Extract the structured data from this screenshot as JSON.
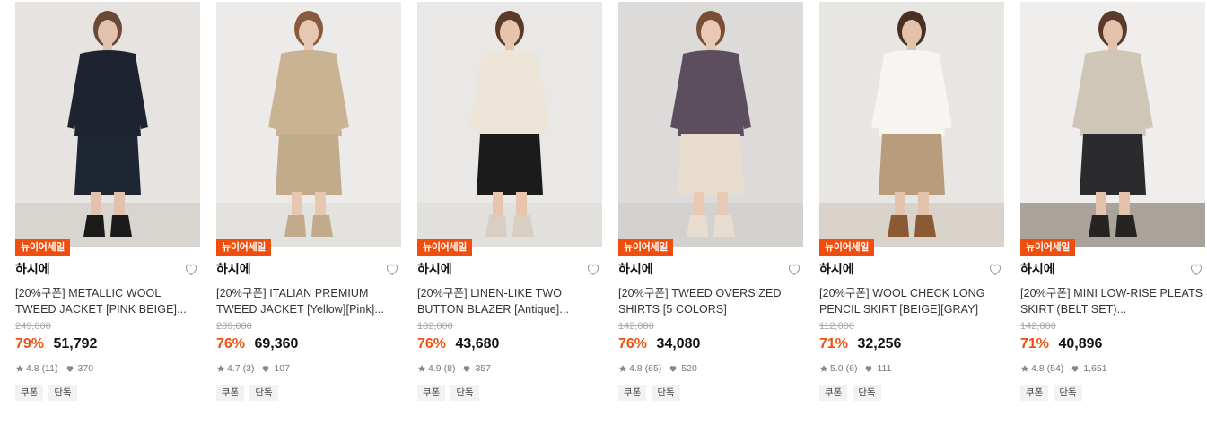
{
  "products": [
    {
      "badge": "뉴이어세일",
      "brand": "하시에",
      "title": "[20%쿠폰] METALLIC WOOL TWEED JACKET [PINK BEIGE]...",
      "original_price": "249,000",
      "discount": "79%",
      "price": "51,792",
      "rating": "4.8",
      "reviews": "(11)",
      "likes": "370",
      "tags": [
        "쿠폰",
        "단독"
      ],
      "image_colors": {
        "bg": "#e6e3e1",
        "floor": "#d8d4cf",
        "top": "#1d2430",
        "bottom": "#1f2633",
        "skin": "#e3c2ad",
        "hair": "#6a4a36",
        "shoes": "#1a1a1a"
      }
    },
    {
      "badge": "뉴이어세일",
      "brand": "하시에",
      "title": "[20%쿠폰] ITALIAN PREMIUM TWEED JACKET [Yellow][Pink]...",
      "original_price": "289,000",
      "discount": "76%",
      "price": "69,360",
      "rating": "4.7",
      "reviews": "(3)",
      "likes": "107",
      "tags": [
        "쿠폰",
        "단독"
      ],
      "image_colors": {
        "bg": "#ecebea",
        "floor": "#e4e2df",
        "top": "#c9b393",
        "bottom": "#c2ab8a",
        "skin": "#e8c7b2",
        "hair": "#8a5a3c",
        "shoes": "#c2ab8a"
      }
    },
    {
      "badge": "뉴이어세일",
      "brand": "하시에",
      "title": "[20%쿠폰] LINEN-LIKE TWO BUTTON BLAZER [Antique]...",
      "original_price": "182,000",
      "discount": "76%",
      "price": "43,680",
      "rating": "4.9",
      "reviews": "(8)",
      "likes": "357",
      "tags": [
        "쿠폰",
        "단독"
      ],
      "image_colors": {
        "bg": "#e9e8e6",
        "floor": "#e2e0dd",
        "top": "#ece5d8",
        "bottom": "#1b1b1b",
        "skin": "#e6c4ae",
        "hair": "#5a3a28",
        "shoes": "#d9cfc0"
      }
    },
    {
      "badge": "뉴이어세일",
      "brand": "하시에",
      "title": "[20%쿠폰] TWEED OVERSIZED SHIRTS [5 COLORS]",
      "original_price": "142,000",
      "discount": "76%",
      "price": "34,080",
      "rating": "4.8",
      "reviews": "(65)",
      "likes": "520",
      "tags": [
        "쿠폰",
        "단독"
      ],
      "image_colors": {
        "bg": "#dcdbd9",
        "floor": "#d4d2cf",
        "top": "#5c4e5e",
        "bottom": "#e7dccd",
        "skin": "#e9c9b4",
        "hair": "#7a4e34",
        "shoes": "#e7dccd"
      }
    },
    {
      "badge": "뉴이어세일",
      "brand": "하시에",
      "title": "[20%쿠폰] WOOL CHECK LONG PENCIL SKIRT [BEIGE][GRAY]",
      "original_price": "112,000",
      "discount": "71%",
      "price": "32,256",
      "rating": "5.0",
      "reviews": "(6)",
      "likes": "111",
      "tags": [
        "쿠폰",
        "단독"
      ],
      "image_colors": {
        "bg": "#e8e6e3",
        "floor": "#d9d3cb",
        "top": "#f6f5f2",
        "bottom": "#b99c7c",
        "skin": "#e3c1aa",
        "hair": "#4a3022",
        "shoes": "#8b5a33"
      }
    },
    {
      "badge": "뉴이어세일",
      "brand": "하시에",
      "title": "[20%쿠폰] MINI LOW-RISE PLEATS SKIRT (BELT SET)...",
      "original_price": "142,000",
      "discount": "71%",
      "price": "40,896",
      "rating": "4.8",
      "reviews": "(54)",
      "likes": "1,651",
      "tags": [
        "쿠폰",
        "단독"
      ],
      "image_colors": {
        "bg": "#efeeec",
        "floor": "#a9a39b",
        "top": "#cfc6b8",
        "bottom": "#2b2b2e",
        "skin": "#e3c1aa",
        "hair": "#5a3a28",
        "shoes": "#252422"
      }
    }
  ],
  "colors": {
    "accent": "#f04e0f",
    "strike": "#aaaaaa",
    "meta": "#777777",
    "tag_bg": "#f2f2f2"
  },
  "icons": {
    "heart": "heart-outline-icon",
    "star": "star-icon",
    "like": "heart-filled-icon"
  }
}
